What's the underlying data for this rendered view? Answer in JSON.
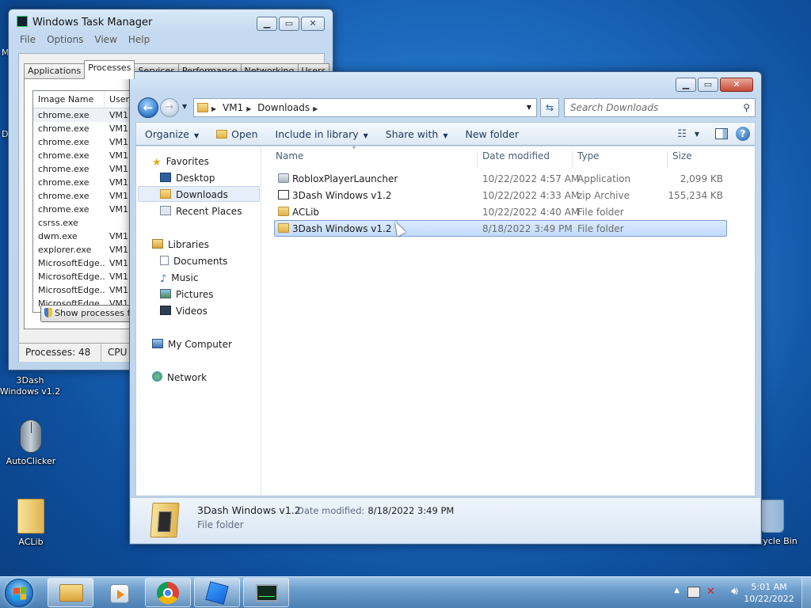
{
  "desktop": {
    "icons": [
      {
        "label": "3Dash\nWindows v1.2"
      },
      {
        "label": "AutoClicker"
      },
      {
        "label": "ACLib"
      },
      {
        "label": "Recycle Bin"
      }
    ],
    "edge_letters": {
      "m": "M",
      "d": "D"
    }
  },
  "taskmgr": {
    "title": "Windows Task Manager",
    "menu": [
      "File",
      "Options",
      "View",
      "Help"
    ],
    "tabs": [
      "Applications",
      "Processes",
      "Services",
      "Performance",
      "Networking",
      "Users"
    ],
    "active_tab": "Processes",
    "columns": [
      "Image Name",
      "User"
    ],
    "rows": [
      {
        "name": "chrome.exe",
        "user": "VM1"
      },
      {
        "name": "chrome.exe",
        "user": "VM1"
      },
      {
        "name": "chrome.exe",
        "user": "VM1"
      },
      {
        "name": "chrome.exe",
        "user": "VM1"
      },
      {
        "name": "chrome.exe",
        "user": "VM1"
      },
      {
        "name": "chrome.exe",
        "user": "VM1"
      },
      {
        "name": "chrome.exe",
        "user": "VM1"
      },
      {
        "name": "chrome.exe",
        "user": "VM1"
      },
      {
        "name": "csrss.exe",
        "user": ""
      },
      {
        "name": "dwm.exe",
        "user": "VM1"
      },
      {
        "name": "explorer.exe",
        "user": "VM1"
      },
      {
        "name": "MicrosoftEdge...",
        "user": "VM1"
      },
      {
        "name": "MicrosoftEdge...",
        "user": "VM1"
      },
      {
        "name": "MicrosoftEdge...",
        "user": "VM1"
      },
      {
        "name": "MicrosoftEdge...",
        "user": "VM1"
      }
    ],
    "show_all_label": "Show processes from",
    "status_processes": "Processes: 48",
    "status_cpu": "CPU Us"
  },
  "explorer": {
    "breadcrumb": [
      "VM1",
      "Downloads"
    ],
    "search_placeholder": "Search Downloads",
    "commands": {
      "organize": "Organize",
      "open": "Open",
      "include": "Include in library",
      "share": "Share with",
      "new_folder": "New folder"
    },
    "nav": {
      "favorites": "Favorites",
      "desktop": "Desktop",
      "downloads": "Downloads",
      "recent": "Recent Places",
      "libraries": "Libraries",
      "documents": "Documents",
      "music": "Music",
      "pictures": "Pictures",
      "videos": "Videos",
      "computer": "My Computer",
      "network": "Network"
    },
    "columns": {
      "name": "Name",
      "date": "Date modified",
      "type": "Type",
      "size": "Size"
    },
    "files": [
      {
        "name": "RobloxPlayerLauncher",
        "date": "10/22/2022 4:57 AM",
        "type": "Application",
        "size": "2,099 KB",
        "icon": "app"
      },
      {
        "name": "3Dash Windows v1.2",
        "date": "10/22/2022 4:33 AM",
        "type": "zip Archive",
        "size": "155,234 KB",
        "icon": "zip"
      },
      {
        "name": "ACLib",
        "date": "10/22/2022 4:40 AM",
        "type": "File folder",
        "size": "",
        "icon": "folder"
      },
      {
        "name": "3Dash Windows v1.2",
        "date": "8/18/2022 3:49 PM",
        "type": "File folder",
        "size": "",
        "icon": "folder"
      }
    ],
    "details": {
      "name": "3Dash Windows v1.2",
      "date_label": "Date modified:",
      "date": "8/18/2022 3:49 PM",
      "type": "File folder"
    }
  },
  "taskbar": {
    "time": "5:01 AM",
    "date": "10/22/2022"
  }
}
